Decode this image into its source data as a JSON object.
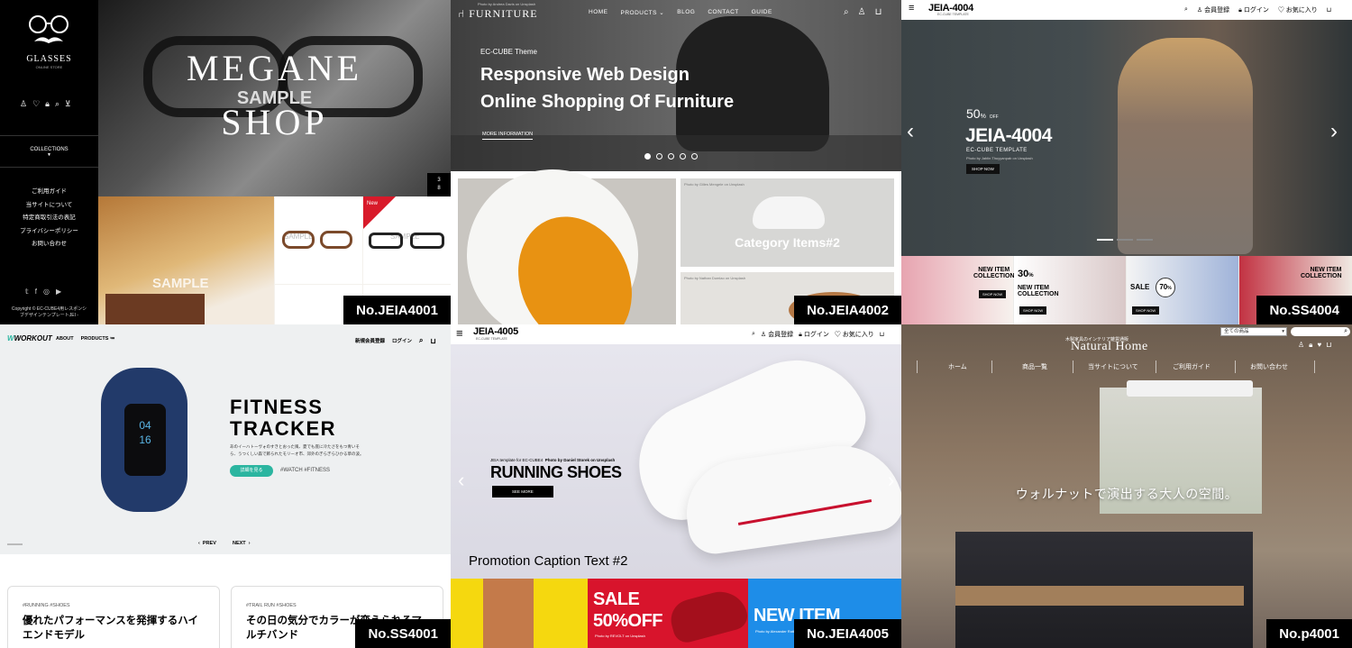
{
  "tiles": {
    "t1": {
      "label": "No.JEIA4001",
      "brand": "GLASSES",
      "brand_sub": "ONLINE STORE",
      "collections": "COLLECTIONS",
      "menu": [
        "ご利用ガイド",
        "当サイトについて",
        "特定商取引法の表記",
        "プライバシーポリシー",
        "お問い合わせ"
      ],
      "copyright": "Copyright © EC-CUBE4用レスポンシ",
      "copyright2": "ブデザインテンプレートJEI -",
      "hero_title1": "MEGANE",
      "hero_title2": "SHOP",
      "sample": "SAMPLE",
      "counter_top": "3",
      "counter_bottom": "8",
      "new_badge": "New"
    },
    "t2": {
      "label": "No.JEIA4002",
      "credit": "Photo by Andrea Davis on Unsplash",
      "logo": "FURNITURE",
      "nav": [
        "HOME",
        "PRODUCTS",
        "BLOG",
        "CONTACT",
        "GUIDE"
      ],
      "theme": "EC-CUBE Theme",
      "title1": "Responsive Web Design",
      "title2": "Online Shopping Of Furniture",
      "more": "MORE INFORMATION",
      "credit2": "Photo by Gilles Mengele on Unsplash",
      "category": "Category Items#2",
      "credit3": "Photo by Nathan Dumlao on Unsplash"
    },
    "t3": {
      "label": "No.SS4004",
      "logo": "JEIA-4004",
      "logo_sub": "EC-CUBE TEMPLATE",
      "nav": [
        "会員登録",
        "ログイン",
        "お気に入り"
      ],
      "off_num": "50",
      "off_pct": "%",
      "off_word": "OFF",
      "hero_title": "JEIA-4004",
      "hero_sub": "EC-CUBE TEMPLATE",
      "hero_credit": "Photo by Jablin Thuyyanpab on Unsplash",
      "shop_now": "SHOP NOW",
      "banner_new": "NEW ITEM",
      "banner_collection": "COLLECTION",
      "banner_pct": "30",
      "sale": "SALE",
      "sale_pct": "70"
    },
    "t4": {
      "label": "No.SS4001",
      "logo": "WORKOUT",
      "nav": [
        "ABOUT",
        "PRODUCTS"
      ],
      "right_nav": [
        "新規会員登録",
        "ログイン"
      ],
      "device_line1": "04",
      "device_line2": "16",
      "title1": "FITNESS",
      "title2": "TRACKER",
      "desc1": "あのイーハトーヴォのすきとおった風、夏でも底に冷たさをもつ青いそ",
      "desc2": "ら、うつくしい森で飾られたモリーオ市、郊外のぎらぎらひかる草の波。",
      "button": "詳細を見る",
      "tags": "#WATCH  #FITNESS",
      "prev": "PREV",
      "next": "NEXT",
      "card1_tags": "#RUNNING   #SHOES",
      "card1_title1": "優れたパフォーマンスを発揮するハイ",
      "card1_title2": "エンドモデル",
      "card2_tags": "#TRAIL RUN   #SHOES",
      "card2_title1": "その日の気分でカラーが変えられるマ",
      "card2_title2": "ルチバンド"
    },
    "t5": {
      "label": "No.JEIA4005",
      "logo": "JEIA-4005",
      "logo_sub": "EC-CUBE TEMPLATE",
      "nav": [
        "会員登録",
        "ログイン",
        "お気に入り"
      ],
      "template_line": "JEIA template for EC-CUBE4",
      "photo_credit": "Photo by Daniel Storek on Unsplash",
      "title": "RUNNING SHOES",
      "see_more": "SEE MORE",
      "caption": "Promotion Caption Text #2",
      "sale": "SALE",
      "sale_off": "50%OFF",
      "sale_credit": "Photo by REVOLT on Unsplash",
      "new_item": "NEW ITEM",
      "new_credit": "Photo by Alexander Rotker on Unsplash"
    },
    "t6": {
      "label": "No.p4001",
      "select": "全ての商品",
      "tagline": "木製家具のインテリア雑貨通販",
      "logo": "Natural Home",
      "nav": [
        "ホーム",
        "商品一覧",
        "当サイトについて",
        "ご利用ガイド",
        "お問い合わせ"
      ],
      "hero": "ウォルナットで演出する大人の空間。"
    }
  },
  "colors": {
    "teal": "#2bb5a0",
    "navy_band": "#1f3566",
    "sale_red": "#d8142c",
    "sale_blue": "#1e8de8",
    "shoe_yellow": "#f5d80f",
    "lamp_orange": "#e89212"
  },
  "icons": [
    "search-icon",
    "user-icon",
    "heart-icon",
    "lock-icon",
    "cart-icon",
    "menu-icon",
    "twitter-icon",
    "facebook-icon",
    "instagram-icon",
    "youtube-icon",
    "chevron-left-icon",
    "chevron-right-icon"
  ]
}
